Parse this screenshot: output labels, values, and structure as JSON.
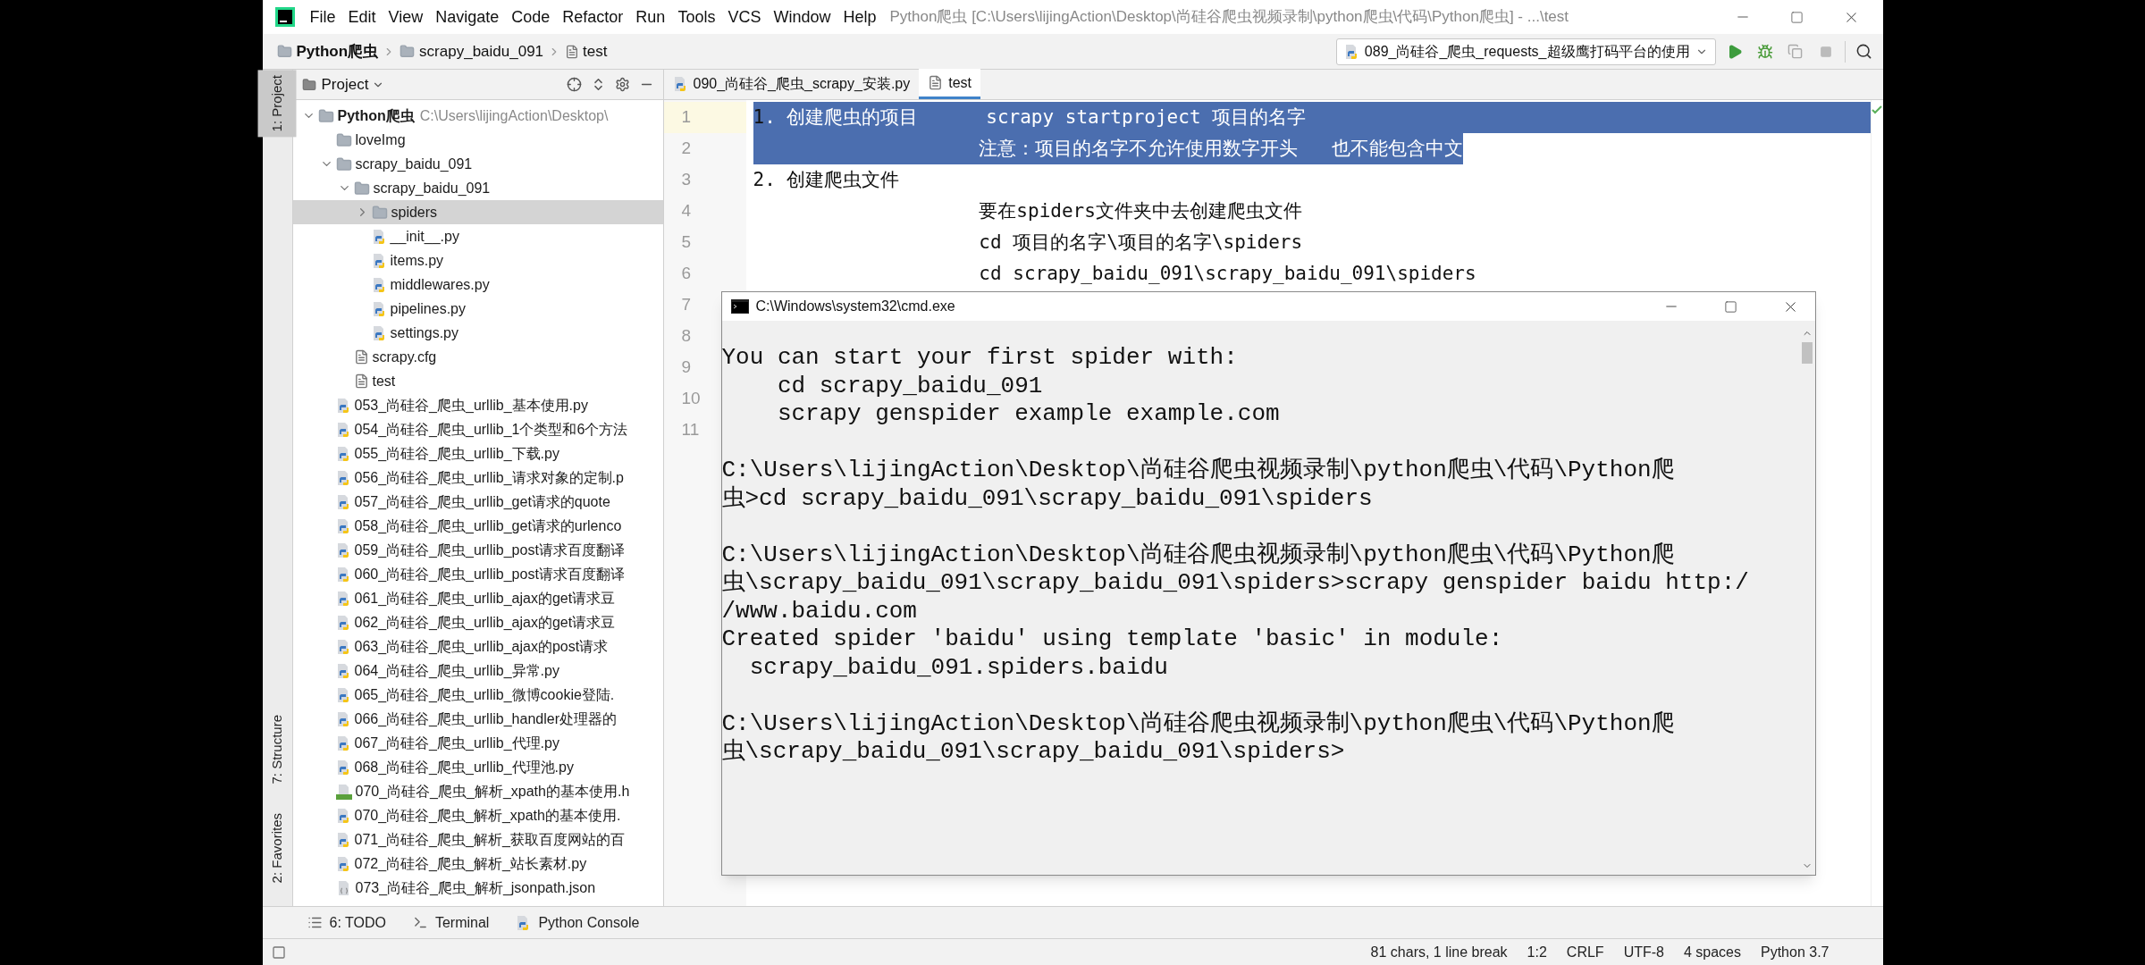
{
  "window": {
    "menu": [
      "File",
      "Edit",
      "View",
      "Navigate",
      "Code",
      "Refactor",
      "Run",
      "Tools",
      "VCS",
      "Window",
      "Help"
    ],
    "title": "Python爬虫 [C:\\Users\\lijingAction\\Desktop\\尚硅谷爬虫视频录制\\python爬虫\\代码\\Python爬虫] - ...\\test"
  },
  "breadcrumbs": [
    {
      "label": "Python爬虫",
      "kind": "project"
    },
    {
      "label": "scrapy_baidu_091",
      "kind": "folder"
    },
    {
      "label": "test",
      "kind": "file"
    }
  ],
  "run_config": {
    "label": "089_尚硅谷_爬虫_requests_超级鹰打码平台的使用"
  },
  "side_tabs": [
    {
      "label": "1: Project",
      "selected": true
    },
    {
      "label": "7: Structure",
      "selected": false
    },
    {
      "label": "2: Favorites",
      "selected": false
    }
  ],
  "project_panel": {
    "title": "Project",
    "tree": [
      {
        "name": "Python爬虫",
        "path": "C:\\Users\\lijingAction\\Desktop\\",
        "kind": "folder",
        "expanded": true,
        "selected": false,
        "children": [
          {
            "name": "loveImg",
            "kind": "folder",
            "selected": false
          },
          {
            "name": "scrapy_baidu_091",
            "kind": "folder",
            "expanded": true,
            "selected": false,
            "children": [
              {
                "name": "scrapy_baidu_091",
                "kind": "folder",
                "expanded": true,
                "selected": false,
                "children": [
                  {
                    "name": "spiders",
                    "kind": "folder",
                    "expanded": false,
                    "selected": true
                  },
                  {
                    "name": "__init__.py",
                    "kind": "python",
                    "selected": false
                  },
                  {
                    "name": "items.py",
                    "kind": "python",
                    "selected": false
                  },
                  {
                    "name": "middlewares.py",
                    "kind": "python",
                    "selected": false
                  },
                  {
                    "name": "pipelines.py",
                    "kind": "python",
                    "selected": false
                  },
                  {
                    "name": "settings.py",
                    "kind": "python",
                    "selected": false
                  }
                ]
              },
              {
                "name": "scrapy.cfg",
                "kind": "text",
                "selected": false
              },
              {
                "name": "test",
                "kind": "text",
                "selected": false
              }
            ]
          },
          {
            "name": "053_尚硅谷_爬虫_urllib_基本使用.py",
            "kind": "python",
            "selected": false
          },
          {
            "name": "054_尚硅谷_爬虫_urllib_1个类型和6个方法",
            "kind": "python",
            "selected": false
          },
          {
            "name": "055_尚硅谷_爬虫_urllib_下载.py",
            "kind": "python",
            "selected": false
          },
          {
            "name": "056_尚硅谷_爬虫_urllib_请求对象的定制.p",
            "kind": "python",
            "selected": false
          },
          {
            "name": "057_尚硅谷_爬虫_urllib_get请求的quote",
            "kind": "python",
            "selected": false
          },
          {
            "name": "058_尚硅谷_爬虫_urllib_get请求的urlenco",
            "kind": "python",
            "selected": false
          },
          {
            "name": "059_尚硅谷_爬虫_urllib_post请求百度翻译",
            "kind": "python",
            "selected": false
          },
          {
            "name": "060_尚硅谷_爬虫_urllib_post请求百度翻译",
            "kind": "python",
            "selected": false
          },
          {
            "name": "061_尚硅谷_爬虫_urllib_ajax的get请求豆",
            "kind": "python",
            "selected": false
          },
          {
            "name": "062_尚硅谷_爬虫_urllib_ajax的get请求豆",
            "kind": "python",
            "selected": false
          },
          {
            "name": "063_尚硅谷_爬虫_urllib_ajax的post请求",
            "kind": "python",
            "selected": false
          },
          {
            "name": "064_尚硅谷_爬虫_urllib_异常.py",
            "kind": "python",
            "selected": false
          },
          {
            "name": "065_尚硅谷_爬虫_urllib_微博cookie登陆.",
            "kind": "python",
            "selected": false
          },
          {
            "name": "066_尚硅谷_爬虫_urllib_handler处理器的",
            "kind": "python",
            "selected": false
          },
          {
            "name": "067_尚硅谷_爬虫_urllib_代理.py",
            "kind": "python",
            "selected": false
          },
          {
            "name": "068_尚硅谷_爬虫_urllib_代理池.py",
            "kind": "python",
            "selected": false
          },
          {
            "name": "070_尚硅谷_爬虫_解析_xpath的基本使用.h",
            "kind": "html",
            "selected": false
          },
          {
            "name": "070_尚硅谷_爬虫_解析_xpath的基本使用.",
            "kind": "python",
            "selected": false
          },
          {
            "name": "071_尚硅谷_爬虫_解析_获取百度网站的百",
            "kind": "python",
            "selected": false
          },
          {
            "name": "072_尚硅谷_爬虫_解析_站长素材.py",
            "kind": "python",
            "selected": false
          },
          {
            "name": "073_尚硅谷_爬虫_解析_jsonpath.json",
            "kind": "json",
            "selected": false
          }
        ]
      }
    ]
  },
  "editor": {
    "tabs": [
      {
        "label": "090_尚硅谷_爬虫_scrapy_安装.py",
        "kind": "python",
        "selected": false
      },
      {
        "label": "test",
        "kind": "text",
        "selected": true
      }
    ],
    "lines": [
      {
        "number": "1",
        "current": true,
        "line_selected": true,
        "segments": [
          {
            "text": "1",
            "selected": false
          },
          {
            "text": ". 创建爬虫的项目      scrapy startproject 项目的名字",
            "selected": true
          }
        ]
      },
      {
        "number": "2",
        "current": false,
        "line_selected": false,
        "segments": [
          {
            "text": "                    注意：项目的名字不允许使用数字开头   也不能包含中文",
            "selected": true
          }
        ]
      },
      {
        "number": "3",
        "current": false,
        "line_selected": false,
        "segments": [
          {
            "text": "2. 创建爬虫文件",
            "selected": false
          }
        ]
      },
      {
        "number": "4",
        "current": false,
        "line_selected": false,
        "segments": [
          {
            "text": "                    要在spiders文件夹中去创建爬虫文件",
            "selected": false
          }
        ]
      },
      {
        "number": "5",
        "current": false,
        "line_selected": false,
        "segments": [
          {
            "text": "                    cd 项目的名字\\项目的名字\\spiders",
            "selected": false
          }
        ]
      },
      {
        "number": "6",
        "current": false,
        "line_selected": false,
        "segments": [
          {
            "text": "                    cd scrapy_baidu_091\\scrapy_baidu_091\\spiders",
            "selected": false
          }
        ]
      },
      {
        "number": "7",
        "current": false,
        "line_selected": false
      },
      {
        "number": "8",
        "current": false,
        "line_selected": false
      },
      {
        "number": "9",
        "current": false,
        "line_selected": false
      },
      {
        "number": "10",
        "current": false,
        "line_selected": false
      },
      {
        "number": "11",
        "current": false,
        "line_selected": false
      }
    ]
  },
  "console_window": {
    "title": "C:\\Windows\\system32\\cmd.exe",
    "blocks": [
      [
        "You can start your first spider with:",
        "    cd scrapy_baidu_091",
        "    scrapy genspider example example.com"
      ],
      [
        "C:\\Users\\lijingAction\\Desktop\\尚硅谷爬虫视频录制\\python爬虫\\代码\\Python爬",
        "虫>cd scrapy_baidu_091\\scrapy_baidu_091\\spiders"
      ],
      [
        "C:\\Users\\lijingAction\\Desktop\\尚硅谷爬虫视频录制\\python爬虫\\代码\\Python爬",
        "虫\\scrapy_baidu_091\\scrapy_baidu_091\\spiders>scrapy genspider baidu http:/",
        "/www.baidu.com",
        "Created spider 'baidu' using template 'basic' in module:",
        "  scrapy_baidu_091.spiders.baidu"
      ],
      [
        "C:\\Users\\lijingAction\\Desktop\\尚硅谷爬虫视频录制\\python爬虫\\代码\\Python爬",
        "虫\\scrapy_baidu_091\\scrapy_baidu_091\\spiders>"
      ]
    ]
  },
  "bottom_tabs": [
    {
      "label": "6: TODO",
      "kind": "todo"
    },
    {
      "label": "Terminal",
      "kind": "terminal"
    },
    {
      "label": "Python Console",
      "kind": "console"
    }
  ],
  "status_bar": [
    "81 chars, 1 line break",
    "1:2",
    "CRLF",
    "UTF-8",
    "4 spaces",
    "Python 3.7"
  ]
}
